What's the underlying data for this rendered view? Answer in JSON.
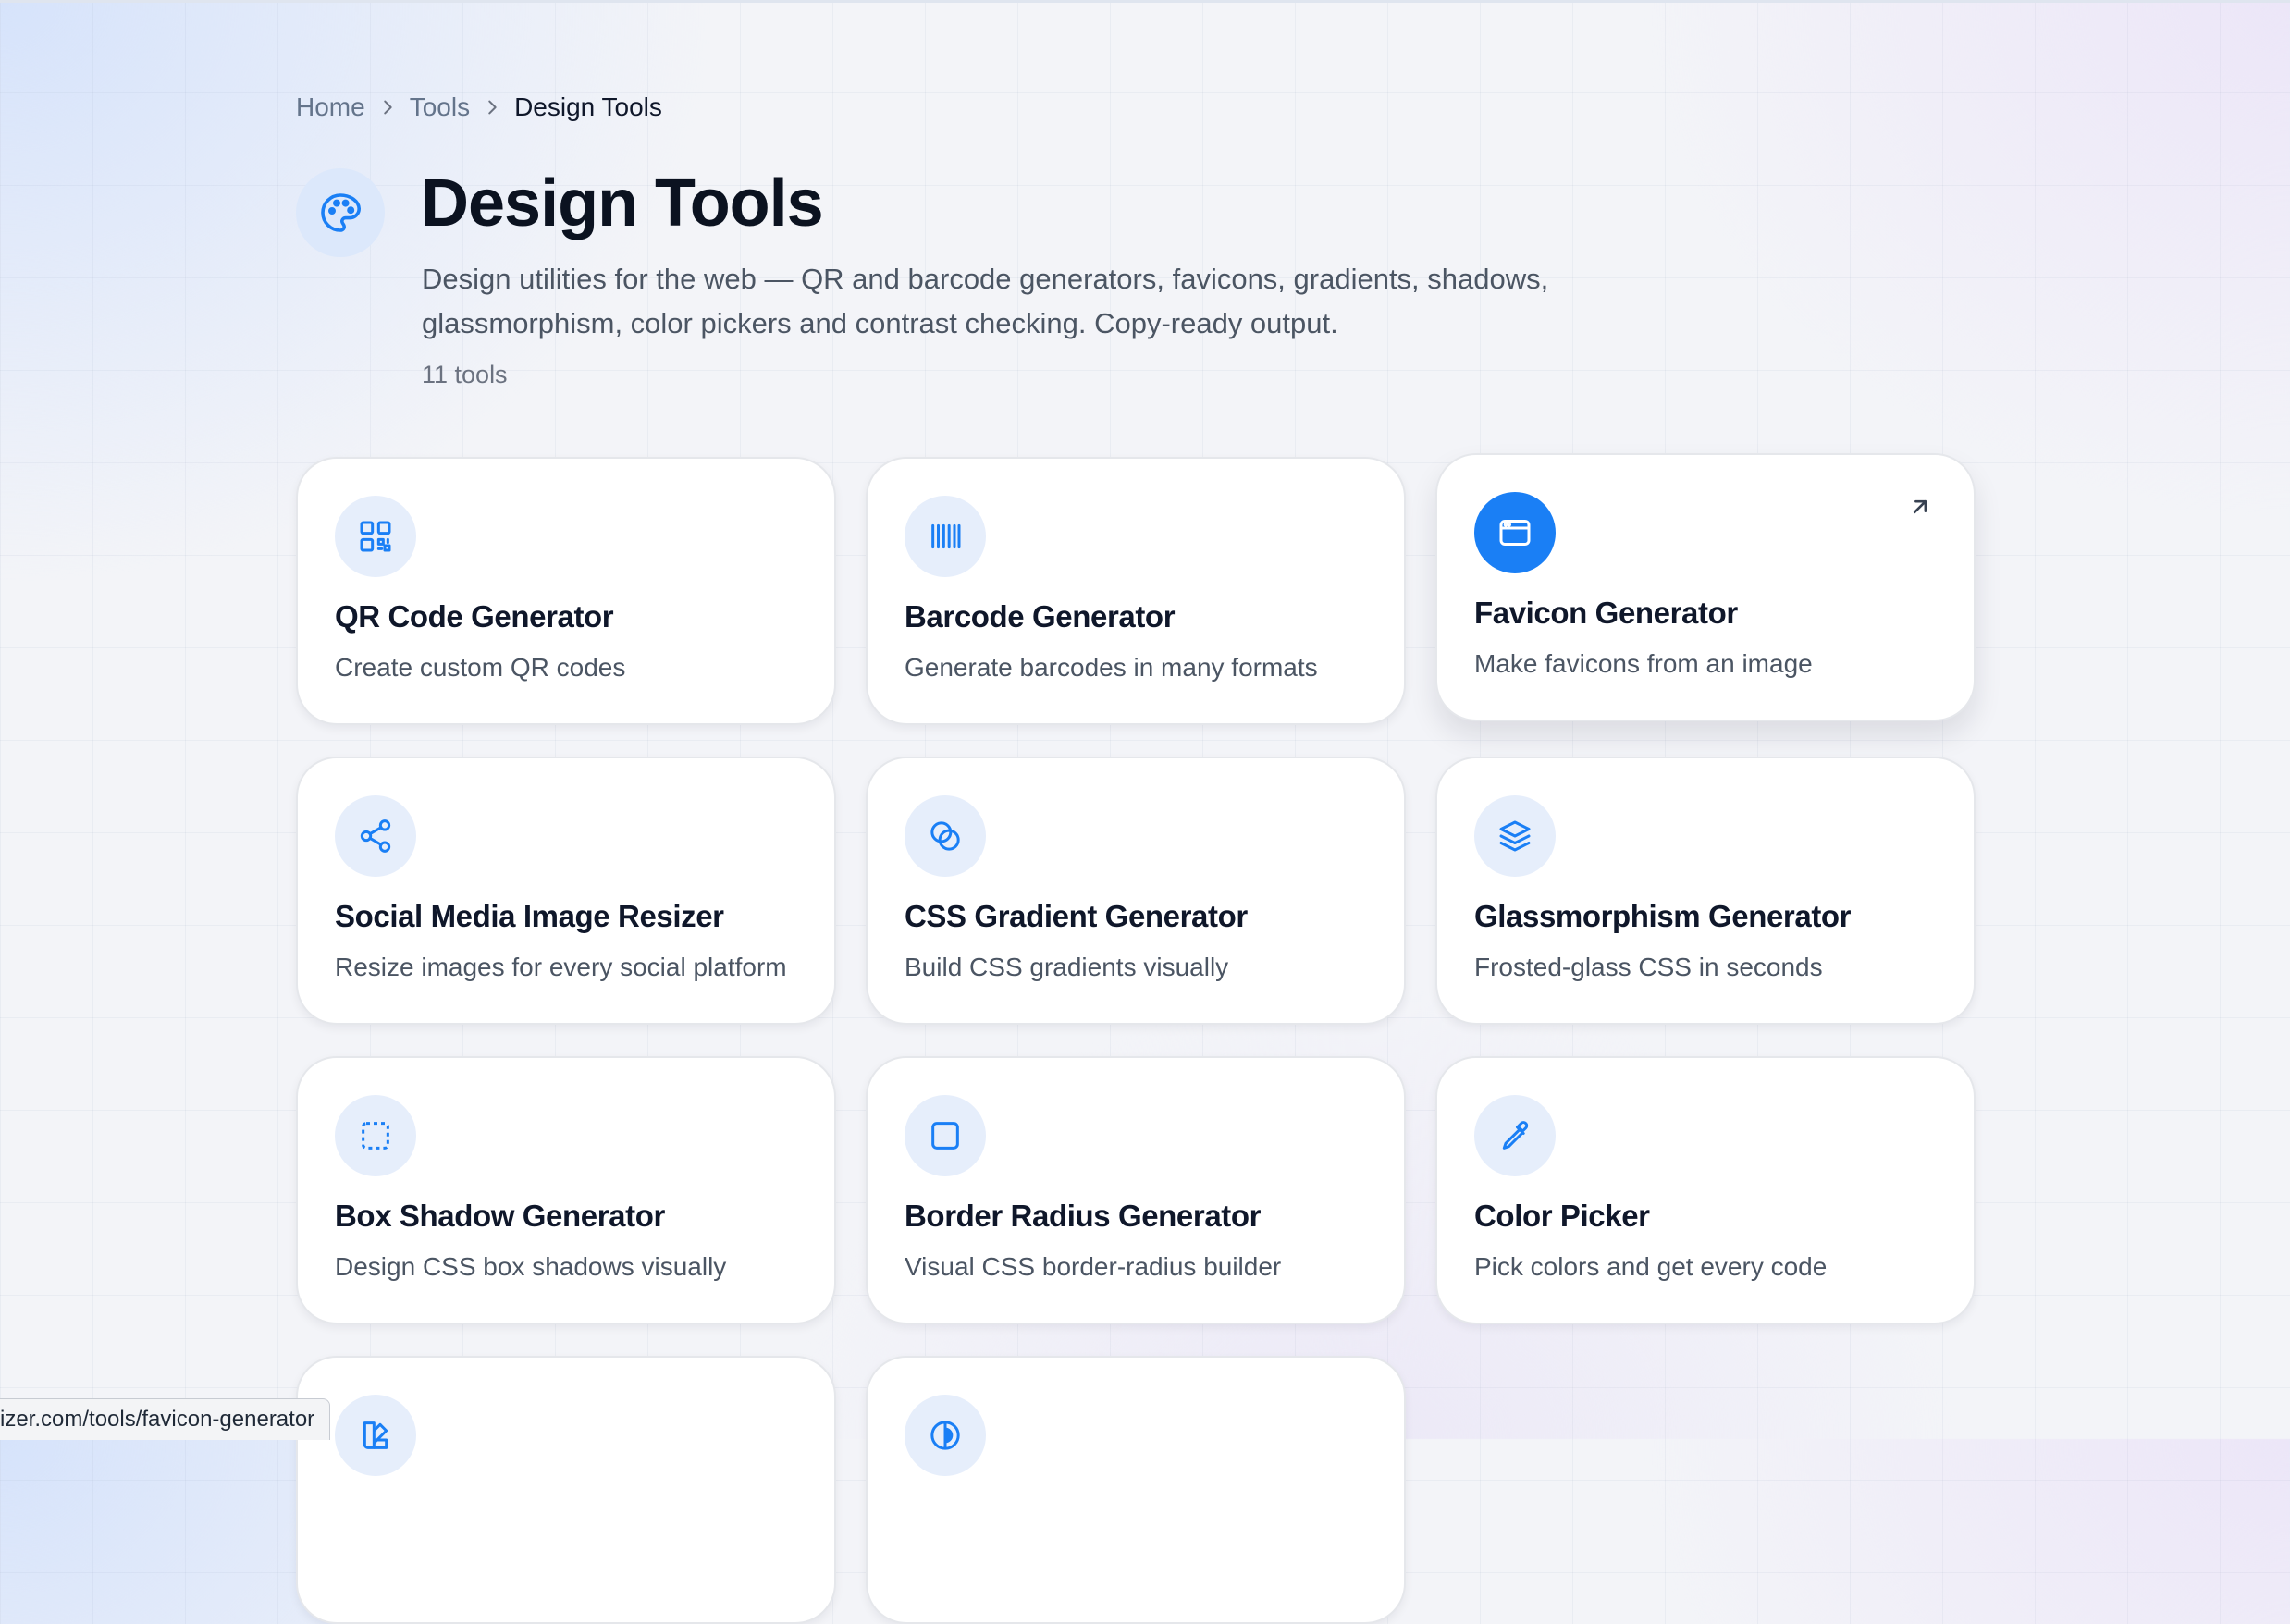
{
  "breadcrumb": {
    "home": "Home",
    "tools": "Tools",
    "current": "Design Tools"
  },
  "header": {
    "icon": "palette-icon",
    "title": "Design Tools",
    "description": "Design utilities for the web — QR and barcode generators, favicons, gradients, shadows, glassmorphism, color pickers and contrast checking. Copy-ready output.",
    "tool_count": "11 tools"
  },
  "accent_color": "#1a7ff5",
  "tools": [
    {
      "title": "QR Code Generator",
      "description": "Create custom QR codes",
      "icon": "qr-code-icon"
    },
    {
      "title": "Barcode Generator",
      "description": "Generate barcodes in many formats",
      "icon": "barcode-icon"
    },
    {
      "title": "Favicon Generator",
      "description": "Make favicons from an image",
      "icon": "browser-window-icon",
      "hovered": true
    },
    {
      "title": "Social Media Image Resizer",
      "description": "Resize images for every social platform",
      "icon": "share-icon"
    },
    {
      "title": "CSS Gradient Generator",
      "description": "Build CSS gradients visually",
      "icon": "blend-icon"
    },
    {
      "title": "Glassmorphism Generator",
      "description": "Frosted-glass CSS in seconds",
      "icon": "layers-icon"
    },
    {
      "title": "Box Shadow Generator",
      "description": "Design CSS box shadows visually",
      "icon": "dashed-square-icon"
    },
    {
      "title": "Border Radius Generator",
      "description": "Visual CSS border-radius builder",
      "icon": "rounded-square-icon"
    },
    {
      "title": "Color Picker",
      "description": "Pick colors and get every code",
      "icon": "pipette-icon"
    },
    {
      "title": "",
      "description": "",
      "icon": "swatch-book-icon"
    },
    {
      "title": "",
      "description": "",
      "icon": "contrast-icon"
    }
  ],
  "status_bar": {
    "url": "izer.com/tools/favicon-generator"
  }
}
